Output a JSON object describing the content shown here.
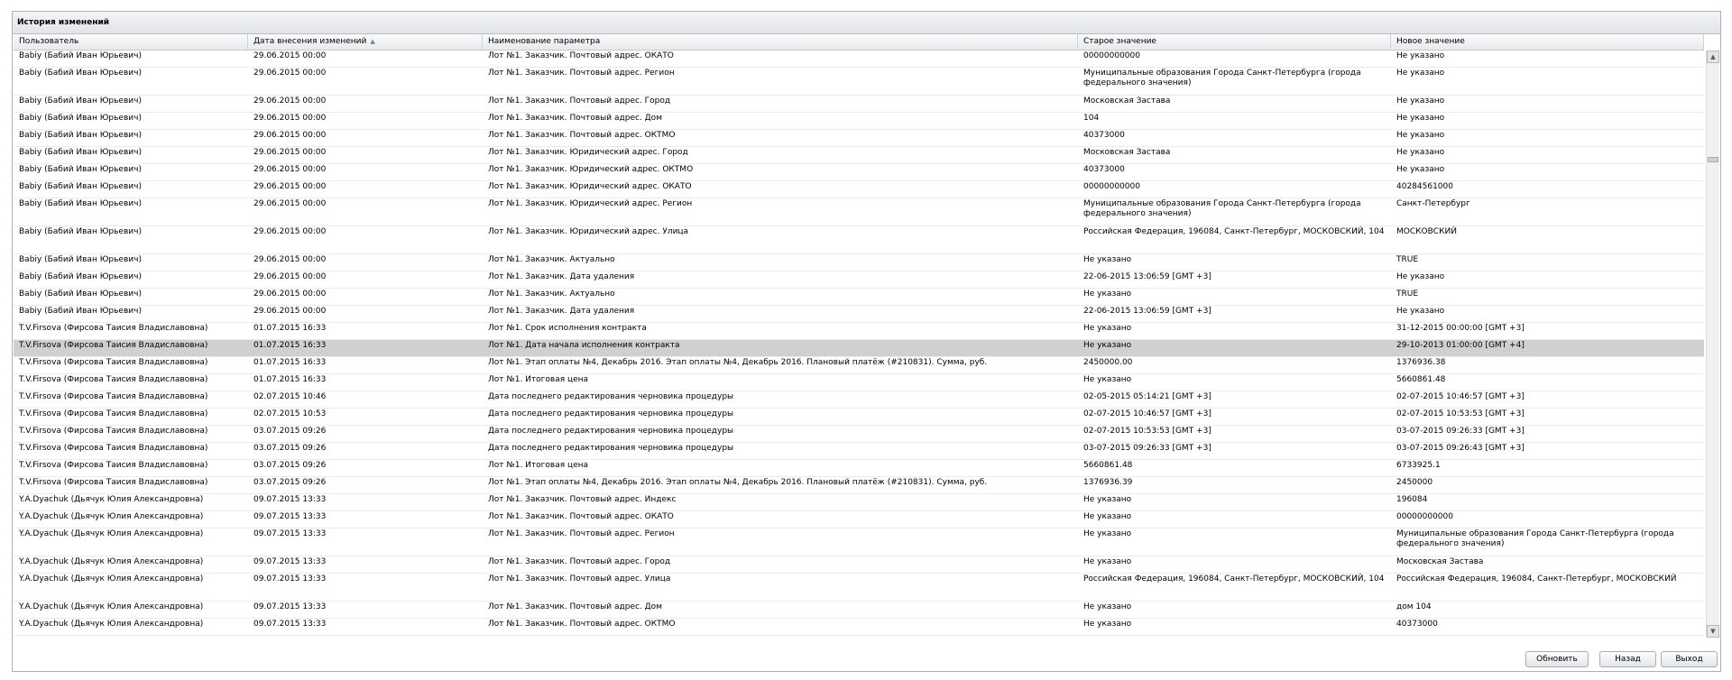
{
  "panel": {
    "title": "История изменений"
  },
  "columns": [
    "Пользователь",
    "Дата внесения изменений",
    "Наименование параметра",
    "Старое значение",
    "Новое значение"
  ],
  "rows": [
    [
      "Babiy (Бабий Иван Юрьевич)",
      "29.06.2015 00:00",
      "Лот №1. Заказчик. Почтовый адрес. ОКАТО",
      "00000000000",
      "Не указано"
    ],
    [
      "Babiy (Бабий Иван Юрьевич)",
      "29.06.2015 00:00",
      "Лот №1. Заказчик. Почтовый адрес. Регион",
      "Муниципальные образования Города Санкт-Петербурга (города федерального значения)",
      "Не указано"
    ],
    [
      "Babiy (Бабий Иван Юрьевич)",
      "29.06.2015 00:00",
      "Лот №1. Заказчик. Почтовый адрес. Город",
      "Московская Застава",
      "Не указано"
    ],
    [
      "Babiy (Бабий Иван Юрьевич)",
      "29.06.2015 00:00",
      "Лот №1. Заказчик. Почтовый адрес. Дом",
      "104",
      "Не указано"
    ],
    [
      "Babiy (Бабий Иван Юрьевич)",
      "29.06.2015 00:00",
      "Лот №1. Заказчик. Почтовый адрес. ОКТМО",
      "40373000",
      "Не указано"
    ],
    [
      "Babiy (Бабий Иван Юрьевич)",
      "29.06.2015 00:00",
      "Лот №1. Заказчик. Юридический адрес. Город",
      "Московская Застава",
      "Не указано"
    ],
    [
      "Babiy (Бабий Иван Юрьевич)",
      "29.06.2015 00:00",
      "Лот №1. Заказчик. Юридический адрес. ОКТМО",
      "40373000",
      "Не указано"
    ],
    [
      "Babiy (Бабий Иван Юрьевич)",
      "29.06.2015 00:00",
      "Лот №1. Заказчик. Юридический адрес. ОКАТО",
      "00000000000",
      "40284561000"
    ],
    [
      "Babiy (Бабий Иван Юрьевич)",
      "29.06.2015 00:00",
      "Лот №1. Заказчик. Юридический адрес. Регион",
      "Муниципальные образования Города Санкт-Петербурга (города федерального значения)",
      "Санкт-Петербург"
    ],
    [
      "Babiy (Бабий Иван Юрьевич)",
      "29.06.2015 00:00",
      "Лот №1. Заказчик. Юридический адрес. Улица",
      "Российская Федерация, 196084, Санкт-Петербург, МОСКОВСКИЙ, 104",
      "МОСКОВСКИЙ"
    ],
    [
      "Babiy (Бабий Иван Юрьевич)",
      "29.06.2015 00:00",
      "Лот №1. Заказчик. Актуально",
      "Не указано",
      "TRUE"
    ],
    [
      "Babiy (Бабий Иван Юрьевич)",
      "29.06.2015 00:00",
      "Лот №1. Заказчик. Дата удаления",
      "22-06-2015 13:06:59 [GMT +3]",
      "Не указано"
    ],
    [
      "Babiy (Бабий Иван Юрьевич)",
      "29.06.2015 00:00",
      "Лот №1. Заказчик. Актуально",
      "Не указано",
      "TRUE"
    ],
    [
      "Babiy (Бабий Иван Юрьевич)",
      "29.06.2015 00:00",
      "Лот №1. Заказчик. Дата удаления",
      "22-06-2015 13:06:59 [GMT +3]",
      "Не указано"
    ],
    [
      "T.V.Firsova (Фирсова Таисия Владиславовна)",
      "01.07.2015 16:33",
      "Лот №1. Срок исполнения контракта",
      "Не указано",
      "31-12-2015 00:00:00 [GMT +3]"
    ],
    [
      "T.V.Firsova (Фирсова Таисия Владиславовна)",
      "01.07.2015 16:33",
      "Лот №1. Дата начала исполнения контракта",
      "Не указано",
      "29-10-2013 01:00:00 [GMT +4]"
    ],
    [
      "T.V.Firsova (Фирсова Таисия Владиславовна)",
      "01.07.2015 16:33",
      "Лот №1. Этап оплаты №4, Декабрь 2016. Этап оплаты №4, Декабрь 2016. Плановый платёж (#210831). Сумма, руб.",
      "2450000.00",
      "1376936.38"
    ],
    [
      "T.V.Firsova (Фирсова Таисия Владиславовна)",
      "01.07.2015 16:33",
      "Лот №1. Итоговая цена",
      "Не указано",
      "5660861.48"
    ],
    [
      "T.V.Firsova (Фирсова Таисия Владиславовна)",
      "02.07.2015 10:46",
      "Дата последнего редактирования черновика процедуры",
      "02-05-2015 05:14:21 [GMT +3]",
      "02-07-2015 10:46:57 [GMT +3]"
    ],
    [
      "T.V.Firsova (Фирсова Таисия Владиславовна)",
      "02.07.2015 10:53",
      "Дата последнего редактирования черновика процедуры",
      "02-07-2015 10:46:57 [GMT +3]",
      "02-07-2015 10:53:53 [GMT +3]"
    ],
    [
      "T.V.Firsova (Фирсова Таисия Владиславовна)",
      "03.07.2015 09:26",
      "Дата последнего редактирования черновика процедуры",
      "02-07-2015 10:53:53 [GMT +3]",
      "03-07-2015 09:26:33 [GMT +3]"
    ],
    [
      "T.V.Firsova (Фирсова Таисия Владиславовна)",
      "03.07.2015 09:26",
      "Дата последнего редактирования черновика процедуры",
      "03-07-2015 09:26:33 [GMT +3]",
      "03-07-2015 09:26:43 [GMT +3]"
    ],
    [
      "T.V.Firsova (Фирсова Таисия Владиславовна)",
      "03.07.2015 09:26",
      "Лот №1. Итоговая цена",
      "5660861.48",
      "6733925.1"
    ],
    [
      "T.V.Firsova (Фирсова Таисия Владиславовна)",
      "03.07.2015 09:26",
      "Лот №1. Этап оплаты №4, Декабрь 2016. Этап оплаты №4, Декабрь 2016. Плановый платёж (#210831). Сумма, руб.",
      "1376936.39",
      "2450000"
    ],
    [
      "Y.A.Dyachuk (Дьячук Юлия Александровна)",
      "09.07.2015 13:33",
      "Лот №1. Заказчик. Почтовый адрес. Индекс",
      "Не указано",
      "196084"
    ],
    [
      "Y.A.Dyachuk (Дьячук Юлия Александровна)",
      "09.07.2015 13:33",
      "Лот №1. Заказчик. Почтовый адрес. ОКАТО",
      "Не указано",
      "00000000000"
    ],
    [
      "Y.A.Dyachuk (Дьячук Юлия Александровна)",
      "09.07.2015 13:33",
      "Лот №1. Заказчик. Почтовый адрес. Регион",
      "Не указано",
      "Муниципальные образования Города Санкт-Петербурга (города федерального значения)"
    ],
    [
      "Y.A.Dyachuk (Дьячук Юлия Александровна)",
      "09.07.2015 13:33",
      "Лот №1. Заказчик. Почтовый адрес. Город",
      "Не указано",
      "Московская Застава"
    ],
    [
      "Y.A.Dyachuk (Дьячук Юлия Александровна)",
      "09.07.2015 13:33",
      "Лот №1. Заказчик. Почтовый адрес. Улица",
      "Российская Федерация, 196084, Санкт-Петербург, МОСКОВСКИЙ, 104",
      "Российская Федерация, 196084, Санкт-Петербург, МОСКОВСКИЙ"
    ],
    [
      "Y.A.Dyachuk (Дьячук Юлия Александровна)",
      "09.07.2015 13:33",
      "Лот №1. Заказчик. Почтовый адрес. Дом",
      "Не указано",
      "дом 104"
    ],
    [
      "Y.A.Dyachuk (Дьячук Юлия Александровна)",
      "09.07.2015 13:33",
      "Лот №1. Заказчик. Почтовый адрес. ОКТМО",
      "Не указано",
      "40373000"
    ]
  ],
  "selected_row": 15,
  "buttons": {
    "refresh": "Обновить",
    "back": "Назад",
    "exit": "Выход"
  }
}
